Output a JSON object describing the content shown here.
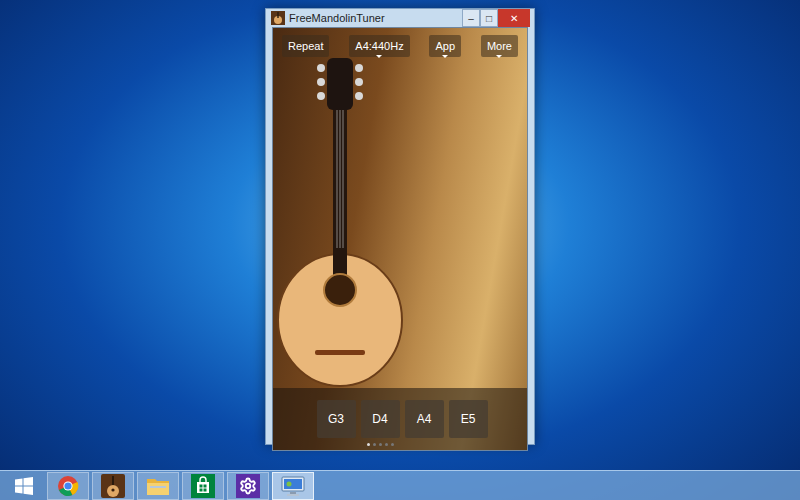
{
  "window": {
    "title": "FreeMandolinTuner",
    "controls": [
      {
        "label": "‒",
        "kind": "minimize"
      },
      {
        "label": "□",
        "kind": "maximize"
      },
      {
        "label": "✕",
        "kind": "close"
      }
    ]
  },
  "toolbar": [
    {
      "label": "Repeat",
      "dropdown": false
    },
    {
      "label": "A4:440Hz",
      "dropdown": true
    },
    {
      "label": "App",
      "dropdown": true
    },
    {
      "label": "More",
      "dropdown": true
    }
  ],
  "strings": [
    {
      "label": "G3",
      "selected": false
    },
    {
      "label": "D4",
      "selected": false
    },
    {
      "label": "A4",
      "selected": false
    },
    {
      "label": "E5",
      "selected": false
    }
  ],
  "page_dots": [
    {
      "selected": true
    },
    {
      "selected": false
    },
    {
      "selected": false
    },
    {
      "selected": false
    },
    {
      "selected": false
    }
  ],
  "taskbar": {
    "items": [
      {
        "kind": "chrome",
        "selected": false
      },
      {
        "kind": "tuner",
        "selected": false
      },
      {
        "kind": "folder",
        "selected": false
      },
      {
        "kind": "store",
        "selected": false
      },
      {
        "kind": "settings",
        "selected": false
      },
      {
        "kind": "remote",
        "selected": true
      }
    ]
  }
}
